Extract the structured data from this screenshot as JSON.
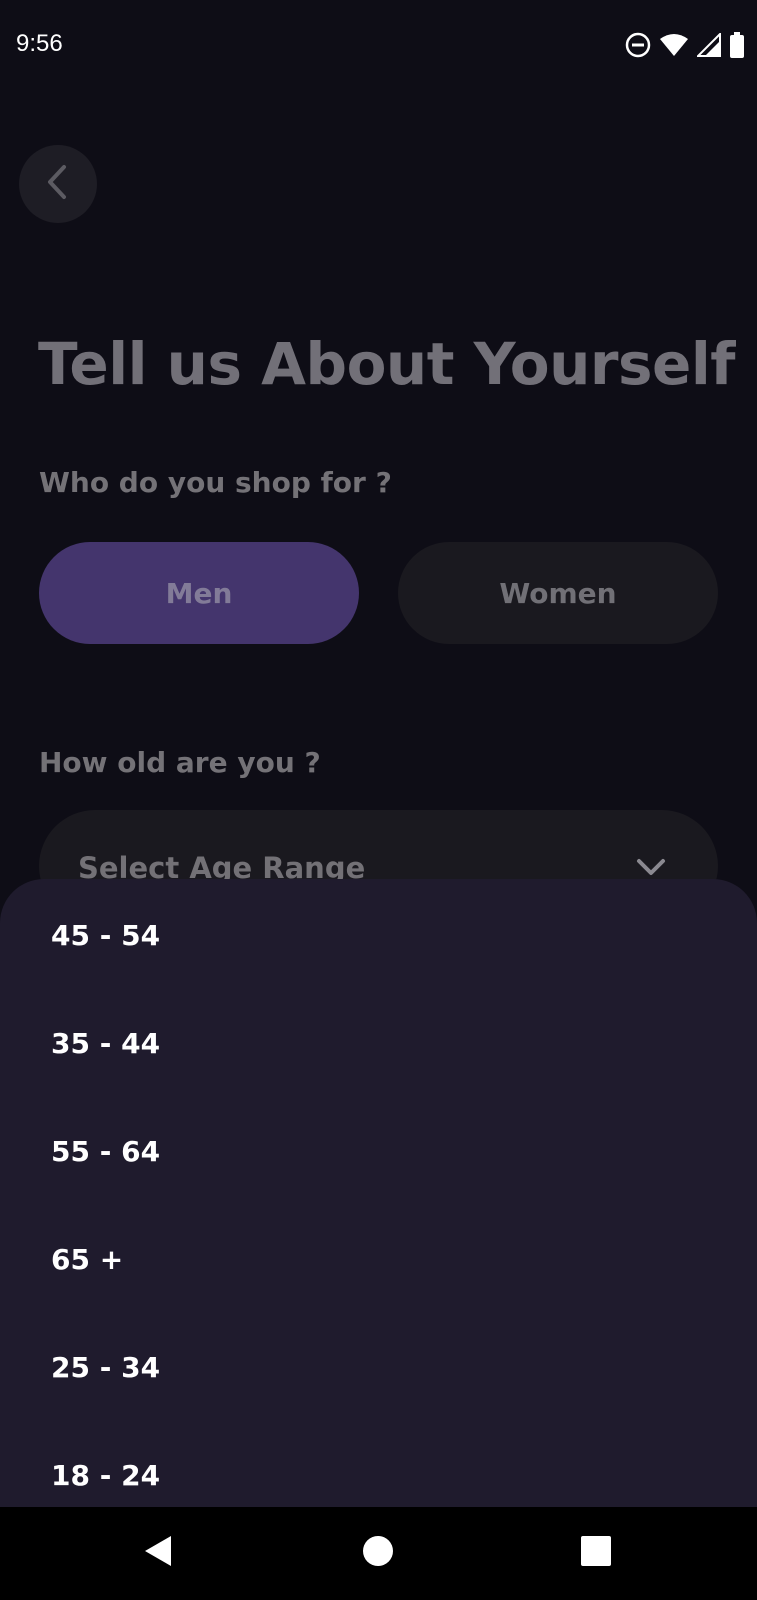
{
  "status_bar": {
    "time": "9:56",
    "icons": [
      "do-not-disturb-icon",
      "wifi-icon",
      "signal-icon",
      "battery-icon"
    ]
  },
  "header": {
    "back_icon": "chevron-left-icon"
  },
  "page": {
    "title": "Tell us About Yourself",
    "shop_label": "Who do you shop for ?",
    "gender_options": [
      {
        "label": "Men",
        "selected": true
      },
      {
        "label": "Women",
        "selected": false
      }
    ],
    "age_label": "How old are you ?",
    "age_select": {
      "placeholder": "Select Age Range",
      "icon": "chevron-down-icon"
    }
  },
  "age_sheet": {
    "options": [
      "45 - 54",
      "35 - 44",
      "55 - 64",
      "65 +",
      "25 - 34",
      "18 - 24"
    ]
  },
  "nav_bar": {
    "buttons": [
      "back-triangle-icon",
      "home-circle-icon",
      "recents-square-icon"
    ]
  },
  "colors": {
    "background": "#0e0d16",
    "accent": "#44356d",
    "sheet": "#1f1b2d",
    "button_dark": "#1a191f"
  }
}
